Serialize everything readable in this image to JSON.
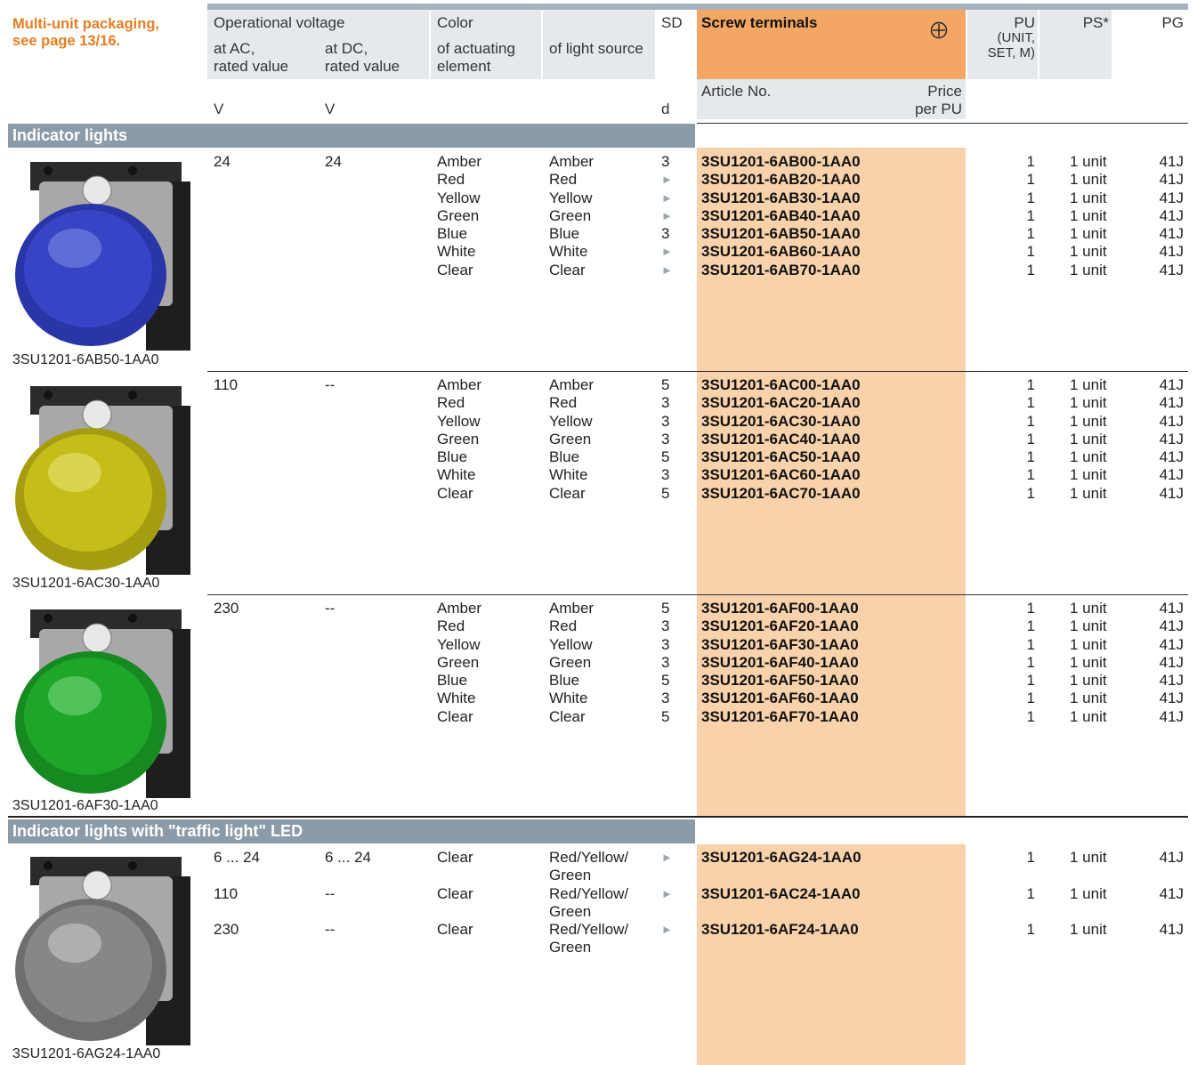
{
  "note": {
    "line1": "Multi-unit packaging,",
    "line2": "see page 13/16."
  },
  "header": {
    "op_voltage": "Operational voltage",
    "at_ac_1": "at AC,",
    "at_ac_2": "rated value",
    "at_dc_1": "at DC,",
    "at_dc_2": "rated value",
    "color": "Color",
    "actuating_1": "of actuating",
    "actuating_2": "element",
    "light_source": "of light source",
    "sd": "SD",
    "screw_terminals": "Screw terminals",
    "pu_1": "PU",
    "pu_2": "(UNIT,",
    "pu_3": "SET, M)",
    "ps": "PS*",
    "pg": "PG",
    "article_no": "Article No.",
    "price_1": "Price",
    "price_2": "per PU",
    "unit_v1": "V",
    "unit_v2": "V",
    "unit_d": "d",
    "screw_icon": "screw-terminal-icon"
  },
  "sections": [
    {
      "title": "Indicator lights",
      "groups": [
        {
          "image_caption": "3SU1201-6AB50-1AA0",
          "lens_color": "#3346c8",
          "ac": "24",
          "dc": "24",
          "actuating": [
            "Amber",
            "Red",
            "Yellow",
            "Green",
            "Blue",
            "White",
            "Clear"
          ],
          "source": [
            "Amber",
            "Red",
            "Yellow",
            "Green",
            "Blue",
            "White",
            "Clear"
          ],
          "sd": [
            "3",
            "►",
            "►",
            "►",
            "3",
            "►",
            "►"
          ],
          "articles": [
            "3SU1201-6AB00-1AA0",
            "3SU1201-6AB20-1AA0",
            "3SU1201-6AB30-1AA0",
            "3SU1201-6AB40-1AA0",
            "3SU1201-6AB50-1AA0",
            "3SU1201-6AB60-1AA0",
            "3SU1201-6AB70-1AA0"
          ],
          "pu": [
            "1",
            "1",
            "1",
            "1",
            "1",
            "1",
            "1"
          ],
          "ps": [
            "1 unit",
            "1 unit",
            "1 unit",
            "1 unit",
            "1 unit",
            "1 unit",
            "1 unit"
          ],
          "pg": [
            "41J",
            "41J",
            "41J",
            "41J",
            "41J",
            "41J",
            "41J"
          ]
        },
        {
          "image_caption": "3SU1201-6AC30-1AA0",
          "lens_color": "#c9c21a",
          "ac": "110",
          "dc": "--",
          "actuating": [
            "Amber",
            "Red",
            "Yellow",
            "Green",
            "Blue",
            "White",
            "Clear"
          ],
          "source": [
            "Amber",
            "Red",
            "Yellow",
            "Green",
            "Blue",
            "White",
            "Clear"
          ],
          "sd": [
            "5",
            "3",
            "3",
            "3",
            "5",
            "3",
            "5"
          ],
          "articles": [
            "3SU1201-6AC00-1AA0",
            "3SU1201-6AC20-1AA0",
            "3SU1201-6AC30-1AA0",
            "3SU1201-6AC40-1AA0",
            "3SU1201-6AC50-1AA0",
            "3SU1201-6AC60-1AA0",
            "3SU1201-6AC70-1AA0"
          ],
          "pu": [
            "1",
            "1",
            "1",
            "1",
            "1",
            "1",
            "1"
          ],
          "ps": [
            "1 unit",
            "1 unit",
            "1 unit",
            "1 unit",
            "1 unit",
            "1 unit",
            "1 unit"
          ],
          "pg": [
            "41J",
            "41J",
            "41J",
            "41J",
            "41J",
            "41J",
            "41J"
          ]
        },
        {
          "image_caption": "3SU1201-6AF30-1AA0",
          "lens_color": "#1fa82a",
          "ac": "230",
          "dc": "--",
          "actuating": [
            "Amber",
            "Red",
            "Yellow",
            "Green",
            "Blue",
            "White",
            "Clear"
          ],
          "source": [
            "Amber",
            "Red",
            "Yellow",
            "Green",
            "Blue",
            "White",
            "Clear"
          ],
          "sd": [
            "5",
            "3",
            "3",
            "3",
            "5",
            "3",
            "5"
          ],
          "articles": [
            "3SU1201-6AF00-1AA0",
            "3SU1201-6AF20-1AA0",
            "3SU1201-6AF30-1AA0",
            "3SU1201-6AF40-1AA0",
            "3SU1201-6AF50-1AA0",
            "3SU1201-6AF60-1AA0",
            "3SU1201-6AF70-1AA0"
          ],
          "pu": [
            "1",
            "1",
            "1",
            "1",
            "1",
            "1",
            "1"
          ],
          "ps": [
            "1 unit",
            "1 unit",
            "1 unit",
            "1 unit",
            "1 unit",
            "1 unit",
            "1 unit"
          ],
          "pg": [
            "41J",
            "41J",
            "41J",
            "41J",
            "41J",
            "41J",
            "41J"
          ]
        }
      ]
    },
    {
      "title": "Indicator lights with \"traffic light\" LED",
      "image_caption": "3SU1201-6AG24-1AA0",
      "lens_color": "#8a8a8a",
      "rows": [
        {
          "ac": "6 ... 24",
          "dc": "6 ... 24",
          "actuating": "Clear",
          "source_1": "Red/Yellow/",
          "source_2": "Green",
          "sd": "►",
          "article": "3SU1201-6AG24-1AA0",
          "pu": "1",
          "ps": "1 unit",
          "pg": "41J"
        },
        {
          "ac": "110",
          "dc": "--",
          "actuating": "Clear",
          "source_1": "Red/Yellow/",
          "source_2": "Green",
          "sd": "►",
          "article": "3SU1201-6AC24-1AA0",
          "pu": "1",
          "ps": "1 unit",
          "pg": "41J"
        },
        {
          "ac": "230",
          "dc": "--",
          "actuating": "Clear",
          "source_1": "Red/Yellow/",
          "source_2": "Green",
          "sd": "►",
          "article": "3SU1201-6AF24-1AA0",
          "pu": "1",
          "ps": "1 unit",
          "pg": "41J"
        }
      ]
    }
  ]
}
